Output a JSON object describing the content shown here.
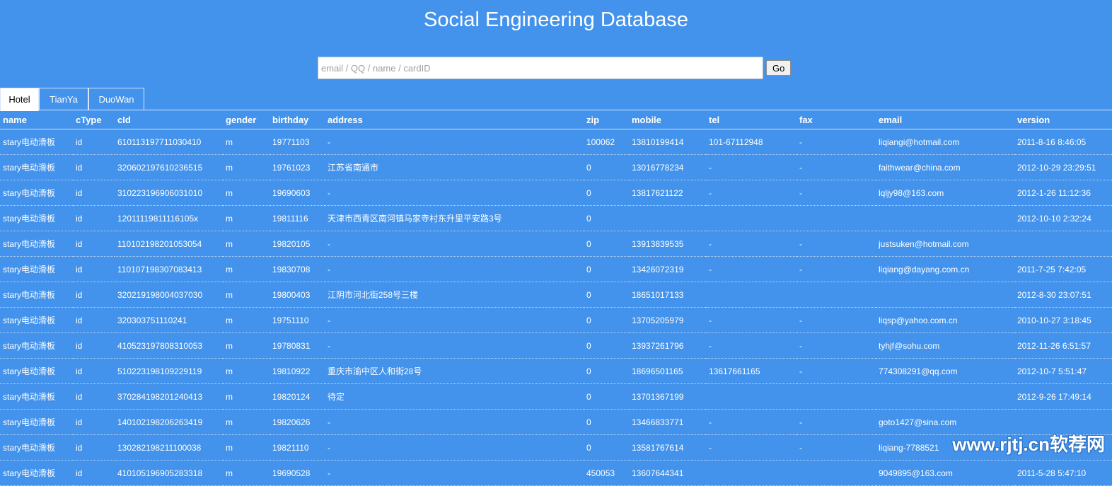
{
  "header": {
    "title": "Social Engineering Database"
  },
  "search": {
    "placeholder": "email / QQ / name / cardID",
    "value": "",
    "button_label": "Go"
  },
  "tabs": [
    {
      "label": "Hotel",
      "active": true
    },
    {
      "label": "TianYa",
      "active": false
    },
    {
      "label": "DuoWan",
      "active": false
    }
  ],
  "table": {
    "columns": [
      "name",
      "cType",
      "cId",
      "gender",
      "birthday",
      "address",
      "zip",
      "mobile",
      "tel",
      "fax",
      "email",
      "version"
    ],
    "rows": [
      [
        "stary电动滑板",
        "id",
        "610113197711030410",
        "m",
        "19771103",
        "-",
        "100062",
        "13810199414",
        "101-67112948",
        "-",
        "liqiangi@hotmail.com",
        "2011-8-16 8:46:05"
      ],
      [
        "stary电动滑板",
        "id",
        "320602197610236515",
        "m",
        "19761023",
        "江苏省南通市",
        "0",
        "13016778234",
        "-",
        "-",
        "faithwear@china.com",
        "2012-10-29 23:29:51"
      ],
      [
        "stary电动滑板",
        "id",
        "310223196906031010",
        "m",
        "19690603",
        "-",
        "0",
        "13817621122",
        "-",
        "-",
        "lqljy98@163.com",
        "2012-1-26 11:12:36"
      ],
      [
        "stary电动滑板",
        "id",
        "12011119811116105x",
        "m",
        "19811116",
        "天津市西青区南河镇马家寺村东升里平安路3号",
        "0",
        "",
        "",
        "",
        "",
        "2012-10-10 2:32:24"
      ],
      [
        "stary电动滑板",
        "id",
        "110102198201053054",
        "m",
        "19820105",
        "-",
        "0",
        "13913839535",
        "-",
        "-",
        "justsuken@hotmail.com",
        ""
      ],
      [
        "stary电动滑板",
        "id",
        "110107198307083413",
        "m",
        "19830708",
        "-",
        "0",
        "13426072319",
        "-",
        "-",
        "liqiang@dayang.com.cn",
        "2011-7-25 7:42:05"
      ],
      [
        "stary电动滑板",
        "id",
        "320219198004037030",
        "m",
        "19800403",
        "江阴市河北街258号三楼",
        "0",
        "18651017133",
        "",
        "",
        "",
        "2012-8-30 23:07:51"
      ],
      [
        "stary电动滑板",
        "id",
        "320303751110241",
        "m",
        "19751110",
        "-",
        "0",
        "13705205979",
        "-",
        "-",
        "liqsp@yahoo.com.cn",
        "2010-10-27 3:18:45"
      ],
      [
        "stary电动滑板",
        "id",
        "410523197808310053",
        "m",
        "19780831",
        "-",
        "0",
        "13937261796",
        "-",
        "-",
        "tyhjf@sohu.com",
        "2012-11-26 6:51:57"
      ],
      [
        "stary电动滑板",
        "id",
        "510223198109229119",
        "m",
        "19810922",
        "重庆市渝中区人和街28号",
        "0",
        "18696501165",
        "13617661165",
        "-",
        "774308291@qq.com",
        "2012-10-7 5:51:47"
      ],
      [
        "stary电动滑板",
        "id",
        "370284198201240413",
        "m",
        "19820124",
        "待定",
        "0",
        "13701367199",
        "",
        "",
        "",
        "2012-9-26 17:49:14"
      ],
      [
        "stary电动滑板",
        "id",
        "140102198206263419",
        "m",
        "19820626",
        "-",
        "0",
        "13466833771",
        "-",
        "-",
        "goto1427@sina.com",
        ""
      ],
      [
        "stary电动滑板",
        "id",
        "130282198211100038",
        "m",
        "19821110",
        "-",
        "0",
        "13581767614",
        "-",
        "-",
        "liqiang-7788521",
        ""
      ],
      [
        "stary电动滑板",
        "id",
        "410105196905283318",
        "m",
        "19690528",
        "-",
        "450053",
        "13607644341",
        "",
        "",
        "9049895@163.com",
        "2011-5-28 5:47:10"
      ]
    ]
  },
  "watermark": {
    "text": "www.rjtj.cn软荐网"
  }
}
